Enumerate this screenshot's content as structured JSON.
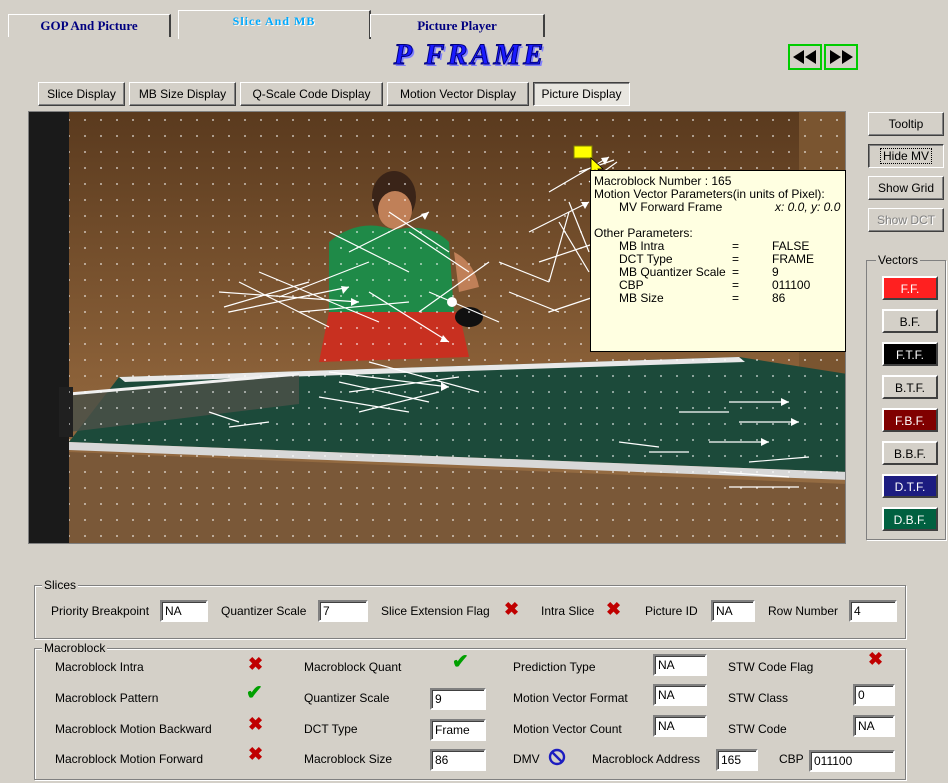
{
  "tabs": [
    "GOP  And  Picture",
    "Slice  And  MB",
    "Picture  Player"
  ],
  "frame_type": "P FRAME",
  "display_buttons": [
    "Slice Display",
    "MB Size Display",
    "Q-Scale Code Display",
    "Motion Vector Display",
    "Picture Display"
  ],
  "right_buttons": {
    "tooltip": "Tooltip",
    "hide_mv": "Hide MV",
    "show_grid": "Show Grid",
    "show_dct": "Show DCT"
  },
  "vectors": {
    "label": "Vectors",
    "items": [
      {
        "label": "F.F.",
        "bg": "#ff2020",
        "fg": "#ffffff"
      },
      {
        "label": "B.F.",
        "bg": "#d4d0c8",
        "fg": "#000000"
      },
      {
        "label": "F.T.F.",
        "bg": "#000000",
        "fg": "#ffffff"
      },
      {
        "label": "B.T.F.",
        "bg": "#d4d0c8",
        "fg": "#000000"
      },
      {
        "label": "F.B.F.",
        "bg": "#800000",
        "fg": "#ffffff"
      },
      {
        "label": "B.B.F.",
        "bg": "#d4d0c8",
        "fg": "#000000"
      },
      {
        "label": "D.T.F.",
        "bg": "#1c1c80",
        "fg": "#ffffff"
      },
      {
        "label": "D.B.F.",
        "bg": "#006040",
        "fg": "#ffffff"
      }
    ]
  },
  "tooltip": {
    "mb_number": "Macroblock Number : 165",
    "mv_header": "Motion Vector Parameters(in units of Pixel):",
    "mv_forward_label": "MV Forward Frame",
    "mv_forward_value": "x: 0.0, y: 0.0",
    "other_header": "Other Parameters:",
    "params": [
      {
        "k": "MB Intra",
        "eq": "=",
        "v": "FALSE"
      },
      {
        "k": "DCT Type",
        "eq": "=",
        "v": "FRAME"
      },
      {
        "k": "MB Quantizer Scale",
        "eq": "=",
        "v": "9"
      },
      {
        "k": "CBP",
        "eq": "=",
        "v": "011100"
      },
      {
        "k": "MB Size",
        "eq": "=",
        "v": "86"
      }
    ]
  },
  "slices": {
    "label": "Slices",
    "priority_breakpoint_label": "Priority Breakpoint",
    "priority_breakpoint": "NA",
    "quantizer_scale_label": "Quantizer Scale",
    "quantizer_scale": "7",
    "slice_extension_flag_label": "Slice Extension Flag",
    "intra_slice_label": "Intra Slice",
    "picture_id_label": "Picture ID",
    "picture_id": "NA",
    "row_number_label": "Row Number",
    "row_number": "4"
  },
  "macroblock": {
    "label": "Macroblock",
    "intra_label": "Macroblock Intra",
    "pattern_label": "Macroblock Pattern",
    "motion_backward_label": "Macroblock Motion Backward",
    "motion_forward_label": "Macroblock Motion Forward",
    "quant_label": "Macroblock Quant",
    "quantizer_scale_label": "Quantizer Scale",
    "quantizer_scale": "9",
    "dct_type_label": "DCT Type",
    "dct_type": "Frame",
    "size_label": "Macroblock Size",
    "size": "86",
    "prediction_type_label": "Prediction Type",
    "prediction_type": "NA",
    "mv_format_label": "Motion Vector Format",
    "mv_format": "NA",
    "mv_count_label": "Motion Vector Count",
    "mv_count": "NA",
    "dmv_label": "DMV",
    "address_label": "Macroblock Address",
    "address": "165",
    "stw_code_flag_label": "STW Code Flag",
    "stw_class_label": "STW Class",
    "stw_class": "0",
    "stw_code_label": "STW Code",
    "stw_code": "NA",
    "cbp_label": "CBP",
    "cbp": "011100"
  },
  "icons": {
    "x": "x-mark-icon",
    "check": "check-mark-icon",
    "no": "prohibited-icon"
  }
}
